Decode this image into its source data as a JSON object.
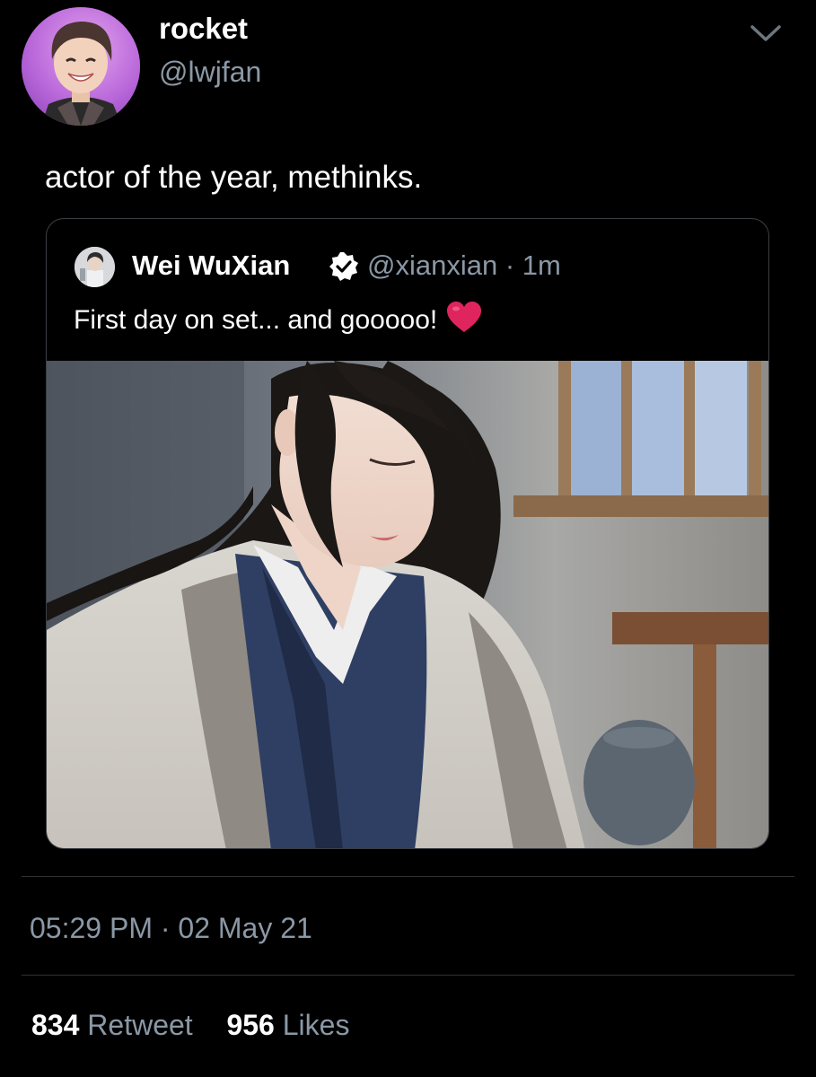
{
  "tweet": {
    "author": {
      "display_name": "rocket",
      "handle": "@lwjfan",
      "avatar_icon": "user-avatar"
    },
    "text": "actor of the year, methinks.",
    "menu_icon": "chevron-down-icon"
  },
  "quoted_tweet": {
    "author": {
      "display_name": "Wei WuXian",
      "verified": true,
      "handle_time": "@xianxian · 1m"
    },
    "text": "First day on set... and gooooo!",
    "emoji": "red-heart-icon",
    "media": "photo"
  },
  "footer": {
    "timestamp": "05:29 PM · 02 May 21",
    "retweets": {
      "count": "834",
      "label": "Retweet"
    },
    "likes": {
      "count": "956",
      "label": "Likes"
    }
  },
  "colors": {
    "background": "#000000",
    "primary_text": "#ffffff",
    "secondary_text": "#8b98a5",
    "divider": "#2f3336",
    "heart": "#e0245e"
  }
}
